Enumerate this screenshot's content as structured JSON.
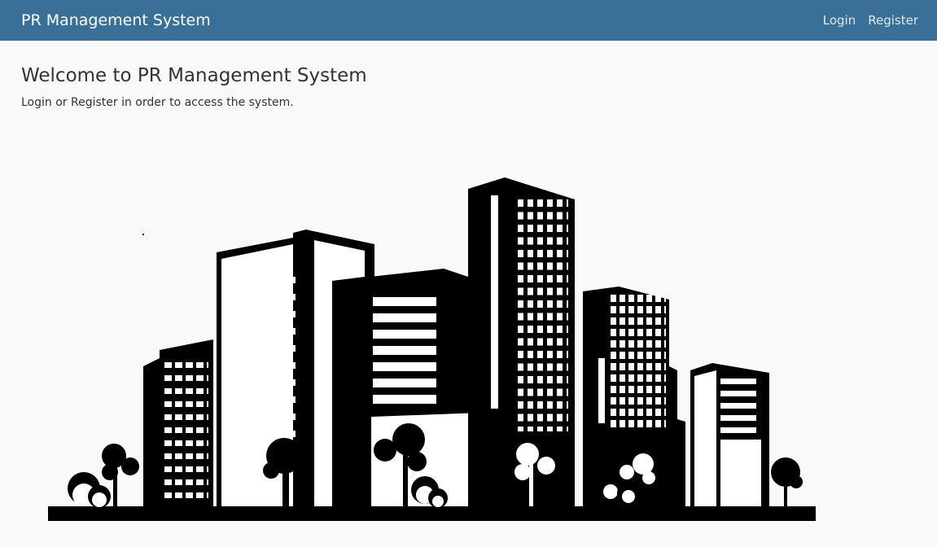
{
  "navbar": {
    "brand": "PR Management System",
    "links": [
      {
        "label": "Login"
      },
      {
        "label": "Register"
      }
    ]
  },
  "main": {
    "title": "Welcome to PR Management System",
    "subtitle": "Login or Register in order to access the system.",
    "illustration": "city-skyline-illustration"
  },
  "colors": {
    "navbar_bg": "#3a7098",
    "page_bg": "#f9f9f9",
    "illustration": "#000000"
  }
}
